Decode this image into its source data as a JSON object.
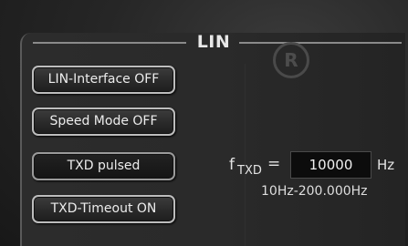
{
  "panel": {
    "title": "LIN",
    "trademark": "R"
  },
  "buttons": [
    {
      "label": "LIN-Interface OFF"
    },
    {
      "label": "Speed Mode OFF"
    },
    {
      "label": "TXD pulsed"
    },
    {
      "label": "TXD-Timeout ON"
    }
  ],
  "frequency": {
    "label_f": "f",
    "label_sub": "TXD",
    "equals": "=",
    "value": "10000",
    "unit": "Hz",
    "range": "10Hz-200.000Hz"
  }
}
